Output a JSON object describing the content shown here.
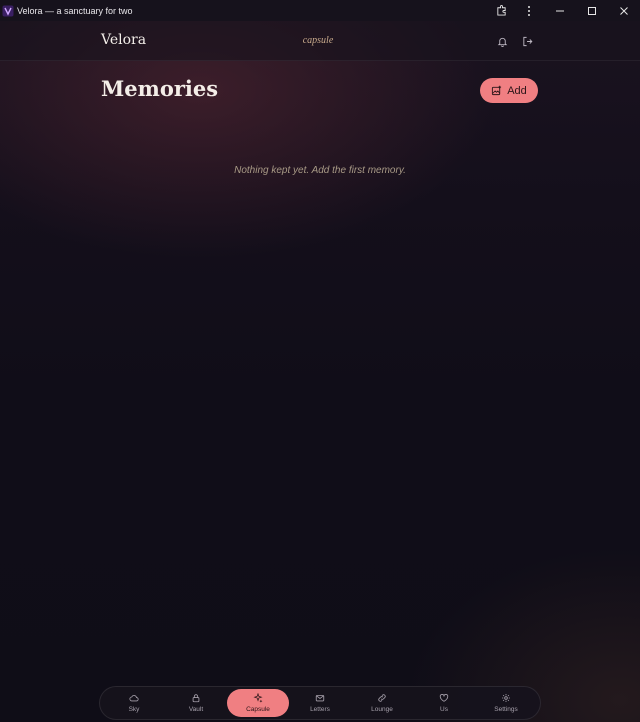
{
  "window": {
    "title": "Velora — a sanctuary for two"
  },
  "header": {
    "brand": "Velora",
    "section": "capsule"
  },
  "page": {
    "title": "Memories",
    "add_label": "Add",
    "empty_message": "Nothing kept yet. Add the first memory."
  },
  "nav": {
    "active": "Capsule",
    "items": [
      {
        "label": "Sky",
        "icon": "cloud-icon"
      },
      {
        "label": "Vault",
        "icon": "lock-icon"
      },
      {
        "label": "Capsule",
        "icon": "sparkles-icon"
      },
      {
        "label": "Letters",
        "icon": "envelope-icon"
      },
      {
        "label": "Lounge",
        "icon": "link-icon"
      },
      {
        "label": "Us",
        "icon": "heart-icon"
      },
      {
        "label": "Settings",
        "icon": "gear-icon"
      }
    ]
  },
  "colors": {
    "accent": "#f07f82",
    "background": "#0f0d17",
    "muted_text": "#a89a86"
  }
}
